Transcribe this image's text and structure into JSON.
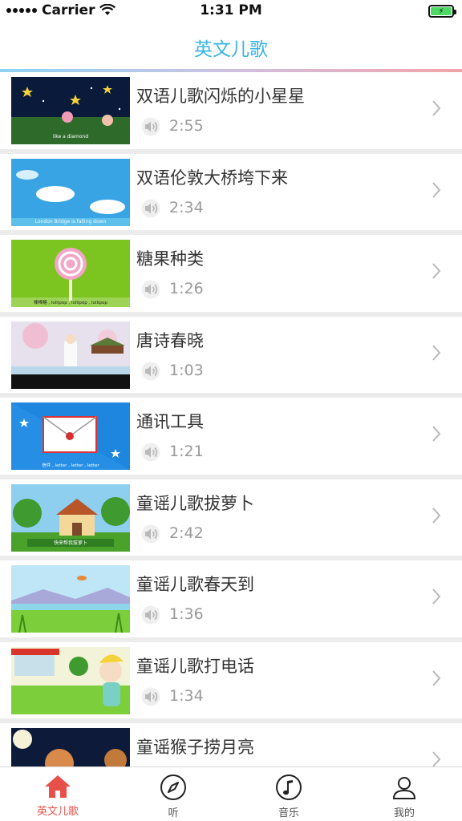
{
  "status": {
    "carrier": "Carrier",
    "time": "1:31 PM"
  },
  "nav": {
    "title": "英文儿歌"
  },
  "colors": {
    "accent": "#3bb4e4",
    "active_tab": "#e8504a",
    "battery": "#4cd964"
  },
  "songs": [
    {
      "title": "双语儿歌闪烁的小星星",
      "duration": "2:55",
      "thumb_caption": "like a diamond"
    },
    {
      "title": "双语伦敦大桥垮下来",
      "duration": "2:34",
      "thumb_caption": "London Bridge is falling down"
    },
    {
      "title": "糖果种类",
      "duration": "1:26",
      "thumb_caption": "棒棒糖 , lollipop , lollipop , lollipop"
    },
    {
      "title": "唐诗春晓",
      "duration": "1:03",
      "thumb_caption": ""
    },
    {
      "title": "通讯工具",
      "duration": "1:21",
      "thumb_caption": "信件 , letter , letter , letter"
    },
    {
      "title": "童谣儿歌拔萝卜",
      "duration": "2:42",
      "thumb_caption": "快来帮我拔萝卜"
    },
    {
      "title": "童谣儿歌春天到",
      "duration": "1:36",
      "thumb_caption": ""
    },
    {
      "title": "童谣儿歌打电话",
      "duration": "1:34",
      "thumb_caption": ""
    },
    {
      "title": "童谣猴子捞月亮",
      "duration": "",
      "thumb_caption": ""
    }
  ],
  "tabs": [
    {
      "label": "英文儿歌",
      "icon": "home-icon",
      "active": true
    },
    {
      "label": "听",
      "icon": "compass-icon",
      "active": false
    },
    {
      "label": "音乐",
      "icon": "music-note-icon",
      "active": false
    },
    {
      "label": "我的",
      "icon": "user-icon",
      "active": false
    }
  ]
}
